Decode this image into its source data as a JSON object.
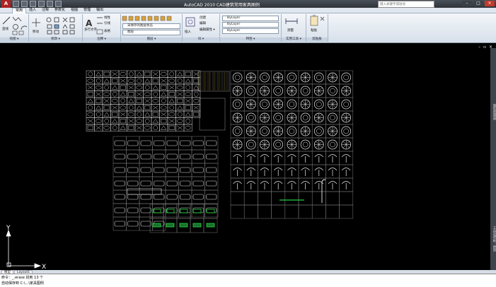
{
  "titlebar": {
    "logo": "A",
    "title": "AutoCAD 2010  CAD建筑常用家具图例",
    "search_placeholder": "键入关键字或短语",
    "window_controls": [
      "–",
      "□",
      "×"
    ]
  },
  "ribbon_tabs": [
    "常用",
    "插入",
    "注释",
    "参数化",
    "视图",
    "管理",
    "输出"
  ],
  "ribbon": {
    "panels": [
      {
        "title": "绘图 ▾",
        "commands": [
          "直线",
          "多段线",
          "圆",
          "圆弧"
        ]
      },
      {
        "title": "修改 ▾",
        "commands": [
          "移动"
        ]
      },
      {
        "title": "注释 ▾",
        "commands": [
          "多行文字",
          "线性",
          "引线",
          "表格"
        ]
      },
      {
        "title": "图层 ▾",
        "commands": [
          "未保存的图层状态",
          "图层"
        ]
      },
      {
        "title": "块 ▾",
        "commands": [
          "插入",
          "创建",
          "编辑",
          "编辑属性 ▾"
        ]
      },
      {
        "title": "特性 ▾",
        "commands": [
          "ByLayer",
          "ByLayer",
          "ByLayer"
        ]
      },
      {
        "title": "实用工具 ▾",
        "commands": [
          "测量"
        ]
      },
      {
        "title": "剪贴板",
        "commands": [
          "粘贴"
        ]
      }
    ]
  },
  "viewport": {
    "controls": "– ▫ ×",
    "ucs_x": "X",
    "ucs_y": "Y"
  },
  "side_palette": {
    "labels": [
      "属性管理器",
      "工具选项板 - 建筑"
    ]
  },
  "layout_tabs": [
    "模型",
    "Layout1"
  ],
  "command_line": {
    "line1": "命令：_.erase 找到 13 个",
    "line2": "自动保存到 C:\\...\\家具图例"
  },
  "colors": {
    "background": "#000000",
    "ribbon": "#dfe6ee",
    "titlebar": "#3a4047",
    "accent_green": "#22dd44"
  }
}
